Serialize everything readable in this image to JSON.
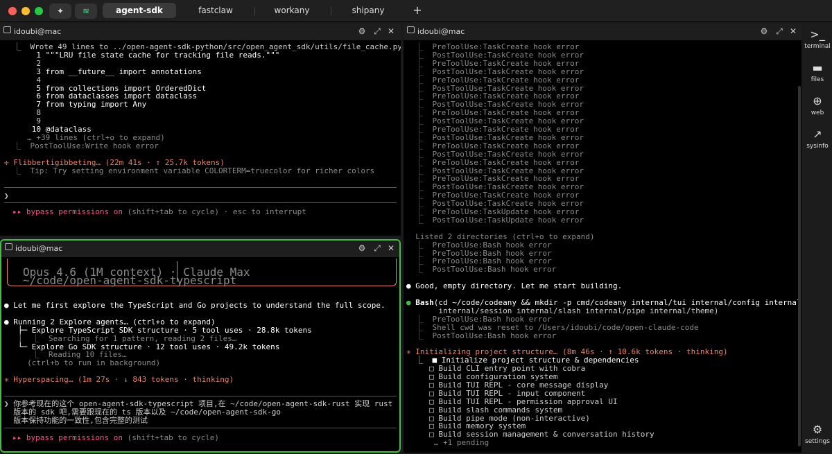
{
  "titlebar": {
    "tabs": [
      "agent-sdk",
      "fastclaw",
      "workany",
      "shipany"
    ],
    "new_tab_label": "+",
    "traffic_colors": [
      "#ff5f57",
      "#febc2e",
      "#28c840"
    ]
  },
  "panes": {
    "top_left": {
      "title": "idoubi@mac",
      "lines": [
        "  ⎿  Wrote 49 lines to ../open-agent-sdk-python/src/open_agent_sdk/utils/file_cache.py",
        "       1 \"\"\"LRU file state cache for tracking file reads.\"\"\"",
        "       2",
        "       3 from __future__ import annotations",
        "       4",
        "       5 from collections import OrderedDict",
        "       6 from dataclasses import dataclass",
        "       7 from typing import Any",
        "       8",
        "       9",
        "      10 @dataclass",
        "     … +39 lines (ctrl+o to expand)",
        "  ⎿  PostToolUse:Write hook error",
        "",
        "✢ Flibbertigibbeting… (22m 41s · ↑ 25.7k tokens)",
        "  ⎿  Tip: Try setting environment variable COLORTERM=truecolor for richer colors"
      ],
      "prompt": "❯",
      "mode_icon": "▸▸",
      "mode": "bypass permissions on",
      "mode_hint": "(shift+tab to cycle) · esc to interrupt"
    },
    "bottom_left": {
      "title": "idoubi@mac",
      "box_lines": [
        "Opus 4.6 (1M context) · Claude Max",
        "~/code/open-agent-sdk-typescript"
      ],
      "lines": [
        "● Let me first explore the TypeScript and Go projects to understand the full scope.",
        "",
        "● Running 2 Explore agents… (ctrl+o to expand)",
        "   ├─ Explore TypeScript SDK structure · 5 tool uses · 28.8k tokens",
        "   │  ⎿  Searching for 1 pattern, reading 2 files…",
        "   └─ Explore Go SDK structure · 12 tool uses · 49.2k tokens",
        "      ⎿  Reading 10 files…",
        "     (ctrl+b to run in background)",
        "",
        "✳ Hyperspacing… (1m 27s · ↓ 843 tokens · thinking)"
      ],
      "input_lines": [
        "❯ 你参考现在的这个 open-agent-sdk-typescript 项目,在 ~/code/open-agent-sdk-rust 实现 rust",
        "  版本的 sdk 吧,需要跟现在的 ts 版本以及 ~/code/open-agent-sdk-go",
        "  版本保持功能的一致性,包含完整的测试"
      ],
      "mode_icon": "▸▸",
      "mode": "bypass permissions on",
      "mode_hint": "(shift+tab to cycle)"
    },
    "right": {
      "title": "idoubi@mac",
      "lines": [
        "  ⎿  PreToolUse:TaskCreate hook error",
        "  ⎿  PostToolUse:TaskCreate hook error",
        "  ⎿  PreToolUse:TaskCreate hook error",
        "  ⎿  PostToolUse:TaskCreate hook error",
        "  ⎿  PreToolUse:TaskCreate hook error",
        "  ⎿  PostToolUse:TaskCreate hook error",
        "  ⎿  PreToolUse:TaskCreate hook error",
        "  ⎿  PostToolUse:TaskCreate hook error",
        "  ⎿  PreToolUse:TaskCreate hook error",
        "  ⎿  PostToolUse:TaskCreate hook error",
        "  ⎿  PreToolUse:TaskCreate hook error",
        "  ⎿  PostToolUse:TaskCreate hook error",
        "  ⎿  PreToolUse:TaskCreate hook error",
        "  ⎿  PostToolUse:TaskCreate hook error",
        "  ⎿  PreToolUse:TaskCreate hook error",
        "  ⎿  PostToolUse:TaskCreate hook error",
        "  ⎿  PreToolUse:TaskCreate hook error",
        "  ⎿  PostToolUse:TaskCreate hook error",
        "  ⎿  PreToolUse:TaskCreate hook error",
        "  ⎿  PostToolUse:TaskCreate hook error",
        "  ⎿  PreToolUse:TaskUpdate hook error",
        "  ⎿  PostToolUse:TaskUpdate hook error",
        "",
        "  Listed 2 directories (ctrl+o to expand)",
        "  ⎿  PreToolUse:Bash hook error",
        "  ⎿  PreToolUse:Bash hook error",
        "  ⎿  PreToolUse:Bash hook error",
        "  ⎿  PostToolUse:Bash hook error",
        "",
        "● Good, empty directory. Let me start building.",
        "",
        "● Bash(cd ~/code/codeany && mkdir -p cmd/codeany internal/tui internal/config internal/memory",
        "       internal/session internal/slash internal/pipe internal/theme)",
        "  ⎿  PreToolUse:Bash hook error",
        "  ⎿  Shell cwd was reset to /Users/idoubi/code/open-claude-code",
        "  ⎿  PostToolUse:Bash hook error",
        "",
        "✳ Initializing project structure… (8m 46s · ↑ 10.6k tokens · thinking)",
        "  ⎿  ■ Initialize project structure & dependencies",
        "     □ Build CLI entry point with cobra",
        "     □ Build configuration system",
        "     □ Build TUI REPL - core message display",
        "     □ Build TUI REPL - input component",
        "     □ Build TUI REPL - permission approval UI",
        "     □ Build slash commands system",
        "     □ Build pipe mode (non-interactive)",
        "     □ Build memory system",
        "     □ Build session management & conversation history",
        "      … +1 pending"
      ]
    }
  },
  "sidebar": [
    {
      "icon": "terminal-icon",
      "label": "terminal",
      "glyph": ">_"
    },
    {
      "icon": "files-icon",
      "label": "files",
      "glyph": "▬"
    },
    {
      "icon": "web-icon",
      "label": "web",
      "glyph": "⊕"
    },
    {
      "icon": "sysinfo-icon",
      "label": "sysinfo",
      "glyph": "↗"
    },
    {
      "icon": "settings-icon",
      "label": "settings",
      "glyph": "⚙"
    }
  ],
  "colors": {
    "accent_green": "#3fbf3f",
    "orange": "#e8836a",
    "pink": "#ff4f8f",
    "keyword": "#ff4f8f"
  }
}
